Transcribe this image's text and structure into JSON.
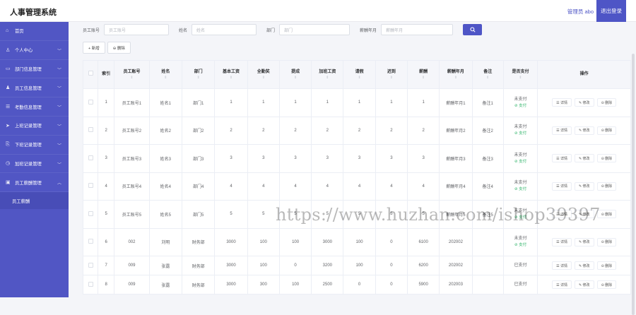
{
  "app": {
    "title": "人事管理系统",
    "admin_label": "管理员 abo",
    "logout_label": "退出登录"
  },
  "sidebar": {
    "items": [
      {
        "label": "首页",
        "icon": "home-icon",
        "glyph": "⌂",
        "has_chevron": false
      },
      {
        "label": "个人中心",
        "icon": "user-icon",
        "glyph": "♙",
        "has_chevron": true
      },
      {
        "label": "部门信息管理",
        "icon": "document-icon",
        "glyph": "▭",
        "has_chevron": true
      },
      {
        "label": "员工信息管理",
        "icon": "people-icon",
        "glyph": "♟",
        "has_chevron": true
      },
      {
        "label": "考勤信息管理",
        "icon": "list-icon",
        "glyph": "☰",
        "has_chevron": true
      },
      {
        "label": "上班记录管理",
        "icon": "send-icon",
        "glyph": "➤",
        "has_chevron": true
      },
      {
        "label": "下班记录管理",
        "icon": "link-icon",
        "glyph": "⎘",
        "has_chevron": true
      },
      {
        "label": "加班记录管理",
        "icon": "clock-icon",
        "glyph": "◷",
        "has_chevron": true
      },
      {
        "label": "员工薪酬管理",
        "icon": "wallet-icon",
        "glyph": "▣",
        "has_chevron": true,
        "expanded": true
      }
    ],
    "sub_item": "员工薪酬"
  },
  "search": {
    "fields": [
      {
        "label": "员工账号",
        "placeholder": "员工账号"
      },
      {
        "label": "姓名",
        "placeholder": "姓名"
      },
      {
        "label": "部门",
        "placeholder": "部门"
      },
      {
        "label": "薪酬年月",
        "placeholder": "薪酬年月"
      }
    ],
    "button_icon": "search-icon"
  },
  "toolbar": {
    "add_label": "+ 新增",
    "delete_label": "⊖ 删除"
  },
  "table": {
    "headers": [
      "索引",
      "员工账号",
      "姓名",
      "部门",
      "基本工资",
      "全勤奖",
      "提成",
      "加班工资",
      "请假",
      "迟到",
      "薪酬",
      "薪酬年月",
      "备注",
      "是否支付",
      "操作"
    ],
    "unpaid_label": "未支付",
    "pay_link_label": "⊘ 支付",
    "ops": {
      "detail": "☰ 详情",
      "edit": "✎ 修改",
      "delete": "⊝ 删除"
    },
    "rows": [
      {
        "idx": "1",
        "account": "员工账号1",
        "name": "姓名1",
        "dept": "部门1",
        "base": "1",
        "attend": "1",
        "commission": "1",
        "overtime": "1",
        "leave": "1",
        "late": "1",
        "salary": "1",
        "month": "薪酬年月1",
        "note": "备注1",
        "paid": "未支付",
        "show_pay": true
      },
      {
        "idx": "2",
        "account": "员工账号2",
        "name": "姓名2",
        "dept": "部门2",
        "base": "2",
        "attend": "2",
        "commission": "2",
        "overtime": "2",
        "leave": "2",
        "late": "2",
        "salary": "2",
        "month": "薪酬年月2",
        "note": "备注2",
        "paid": "未支付",
        "show_pay": true
      },
      {
        "idx": "3",
        "account": "员工账号3",
        "name": "姓名3",
        "dept": "部门3",
        "base": "3",
        "attend": "3",
        "commission": "3",
        "overtime": "3",
        "leave": "3",
        "late": "3",
        "salary": "3",
        "month": "薪酬年月3",
        "note": "备注3",
        "paid": "未支付",
        "show_pay": true
      },
      {
        "idx": "4",
        "account": "员工账号4",
        "name": "姓名4",
        "dept": "部门4",
        "base": "4",
        "attend": "4",
        "commission": "4",
        "overtime": "4",
        "leave": "4",
        "late": "4",
        "salary": "4",
        "month": "薪酬年月4",
        "note": "备注4",
        "paid": "未支付",
        "show_pay": true
      },
      {
        "idx": "5",
        "account": "员工账号5",
        "name": "姓名5",
        "dept": "部门5",
        "base": "5",
        "attend": "5",
        "commission": "5",
        "overtime": "5",
        "leave": "5",
        "late": "5",
        "salary": "5",
        "month": "薪酬年月5",
        "note": "备注5",
        "paid": "未支付",
        "show_pay": true
      },
      {
        "idx": "6",
        "account": "002",
        "name": "刘明",
        "dept": "财务部",
        "base": "3000",
        "attend": "100",
        "commission": "100",
        "overtime": "3000",
        "leave": "100",
        "late": "0",
        "salary": "6100",
        "month": "202002",
        "note": "",
        "paid": "未支付",
        "show_pay": true
      },
      {
        "idx": "7",
        "account": "009",
        "name": "张露",
        "dept": "财务部",
        "base": "3000",
        "attend": "100",
        "commission": "0",
        "overtime": "3200",
        "leave": "100",
        "late": "0",
        "salary": "6200",
        "month": "202002",
        "note": "",
        "paid": "已支付",
        "show_pay": false
      },
      {
        "idx": "8",
        "account": "009",
        "name": "张露",
        "dept": "财务部",
        "base": "3000",
        "attend": "300",
        "commission": "100",
        "overtime": "2500",
        "leave": "0",
        "late": "0",
        "salary": "5900",
        "month": "202003",
        "note": "",
        "paid": "已支付",
        "show_pay": false
      }
    ]
  },
  "watermark": "https://www.huzhan.com/ishop39397",
  "colors": {
    "accent": "#4e55c6",
    "sidebar": "#5156c4",
    "pay_link": "#30b46a"
  }
}
